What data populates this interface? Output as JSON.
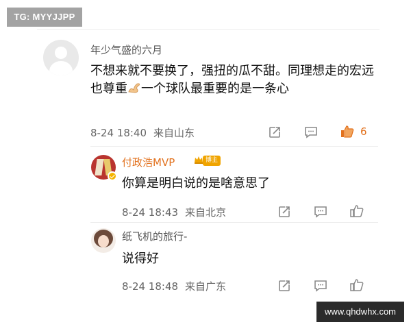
{
  "watermarks": {
    "top_left": "TG: MYYJJPP",
    "bottom_right": "www.qhdwhx.com"
  },
  "colors": {
    "accent_orange": "#e2711d",
    "meta_gray": "#666666",
    "icon_gray": "#888888",
    "badge_gold": "#f0a400"
  },
  "comment": {
    "username": "年少气盛的六月",
    "text_before_emoji": "不想来就不要换了，强扭的瓜不甜。同理想走的宏远也尊重",
    "emoji": "flexed-biceps-icon",
    "text_after_emoji": "一个球队最重要的是一条心",
    "date": "8-24 18:40",
    "location": "来自山东",
    "like_count": "6",
    "liked": true
  },
  "replies": [
    {
      "username": "付政浩MVP",
      "badge": "博主",
      "verified": true,
      "text": "你算是明白说的是啥意思了",
      "date": "8-24 18:43",
      "location": "来自北京"
    },
    {
      "username": "纸飞机的旅行-",
      "text": "说得好",
      "date": "8-24 18:48",
      "location": "来自广东"
    }
  ],
  "actions": {
    "share": "share-icon",
    "comment": "comment-icon",
    "like": "thumbs-up-icon"
  }
}
